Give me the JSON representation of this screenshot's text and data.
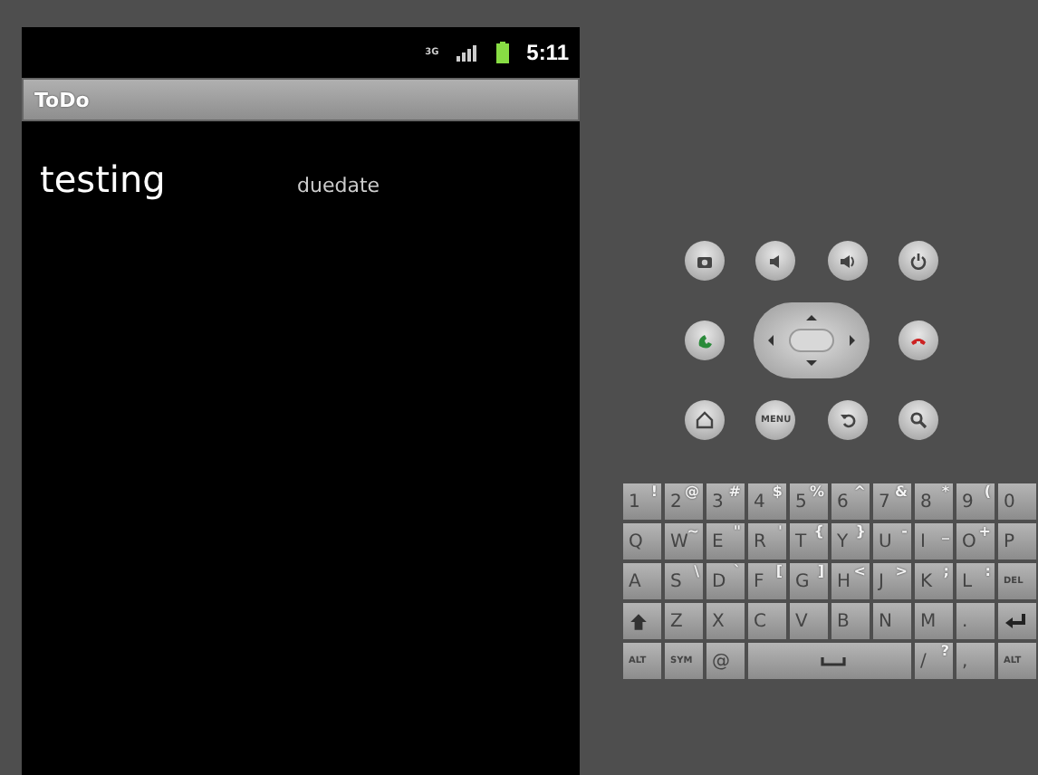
{
  "status_bar": {
    "network": "3G",
    "time": "5:11"
  },
  "title_bar": {
    "title": "ToDo"
  },
  "todo_items": [
    {
      "title": "testing",
      "due": "duedate"
    }
  ],
  "controls": {
    "rows": [
      [
        {
          "kind": "camera"
        },
        {
          "kind": "volume-down"
        },
        {
          "kind": "volume-up"
        },
        {
          "kind": "power"
        }
      ],
      [
        {
          "kind": "call"
        },
        {
          "kind": "dpad"
        },
        {
          "kind": "end-call"
        }
      ],
      [
        {
          "kind": "home"
        },
        {
          "kind": "menu",
          "label": "MENU"
        },
        {
          "kind": "back"
        },
        {
          "kind": "search"
        }
      ]
    ]
  },
  "keyboard": {
    "rows": [
      {
        "keys": [
          {
            "kind": "char",
            "label": "1",
            "alt": "!"
          },
          {
            "kind": "char",
            "label": "2",
            "alt": "@"
          },
          {
            "kind": "char",
            "label": "3",
            "alt": "#"
          },
          {
            "kind": "char",
            "label": "4",
            "alt": "$"
          },
          {
            "kind": "char",
            "label": "5",
            "alt": "%"
          },
          {
            "kind": "char",
            "label": "6",
            "alt": "^"
          },
          {
            "kind": "char",
            "label": "7",
            "alt": "&"
          },
          {
            "kind": "char",
            "label": "8",
            "alt": "*"
          },
          {
            "kind": "char",
            "label": "9",
            "alt": "("
          },
          {
            "kind": "char",
            "label": "0"
          }
        ]
      },
      {
        "keys": [
          {
            "kind": "char",
            "label": "Q"
          },
          {
            "kind": "char",
            "label": "W",
            "alt": "~"
          },
          {
            "kind": "char",
            "label": "E",
            "alt": "\""
          },
          {
            "kind": "char",
            "label": "R",
            "alt": "'"
          },
          {
            "kind": "char",
            "label": "T",
            "alt": "{"
          },
          {
            "kind": "char",
            "label": "Y",
            "alt": "}"
          },
          {
            "kind": "char",
            "label": "U",
            "alt": "-"
          },
          {
            "kind": "char",
            "label": "I",
            "alt": "_"
          },
          {
            "kind": "char",
            "label": "O",
            "alt": "+"
          },
          {
            "kind": "char",
            "label": "P"
          }
        ]
      },
      {
        "keys": [
          {
            "kind": "char",
            "label": "A"
          },
          {
            "kind": "char",
            "label": "S",
            "alt": "\\"
          },
          {
            "kind": "char",
            "label": "D",
            "alt": "`"
          },
          {
            "kind": "char",
            "label": "F",
            "alt": "["
          },
          {
            "kind": "char",
            "label": "G",
            "alt": "]"
          },
          {
            "kind": "char",
            "label": "H",
            "alt": "<"
          },
          {
            "kind": "char",
            "label": "J",
            "alt": ">"
          },
          {
            "kind": "char",
            "label": "K",
            "alt": ";"
          },
          {
            "kind": "char",
            "label": "L",
            "alt": ":"
          },
          {
            "kind": "del",
            "label": "DEL"
          }
        ]
      },
      {
        "keys": [
          {
            "kind": "shift"
          },
          {
            "kind": "char",
            "label": "Z"
          },
          {
            "kind": "char",
            "label": "X"
          },
          {
            "kind": "char",
            "label": "C"
          },
          {
            "kind": "char",
            "label": "V"
          },
          {
            "kind": "char",
            "label": "B"
          },
          {
            "kind": "char",
            "label": "N"
          },
          {
            "kind": "char",
            "label": "M"
          },
          {
            "kind": "char",
            "label": "."
          },
          {
            "kind": "enter"
          }
        ]
      },
      {
        "keys": [
          {
            "kind": "small",
            "label": "ALT"
          },
          {
            "kind": "small",
            "label": "SYM"
          },
          {
            "kind": "char",
            "label": "@"
          },
          {
            "kind": "space"
          },
          {
            "kind": "char",
            "label": "/",
            "alt": "?"
          },
          {
            "kind": "char",
            "label": ","
          },
          {
            "kind": "small",
            "label": "ALT"
          }
        ]
      }
    ]
  }
}
